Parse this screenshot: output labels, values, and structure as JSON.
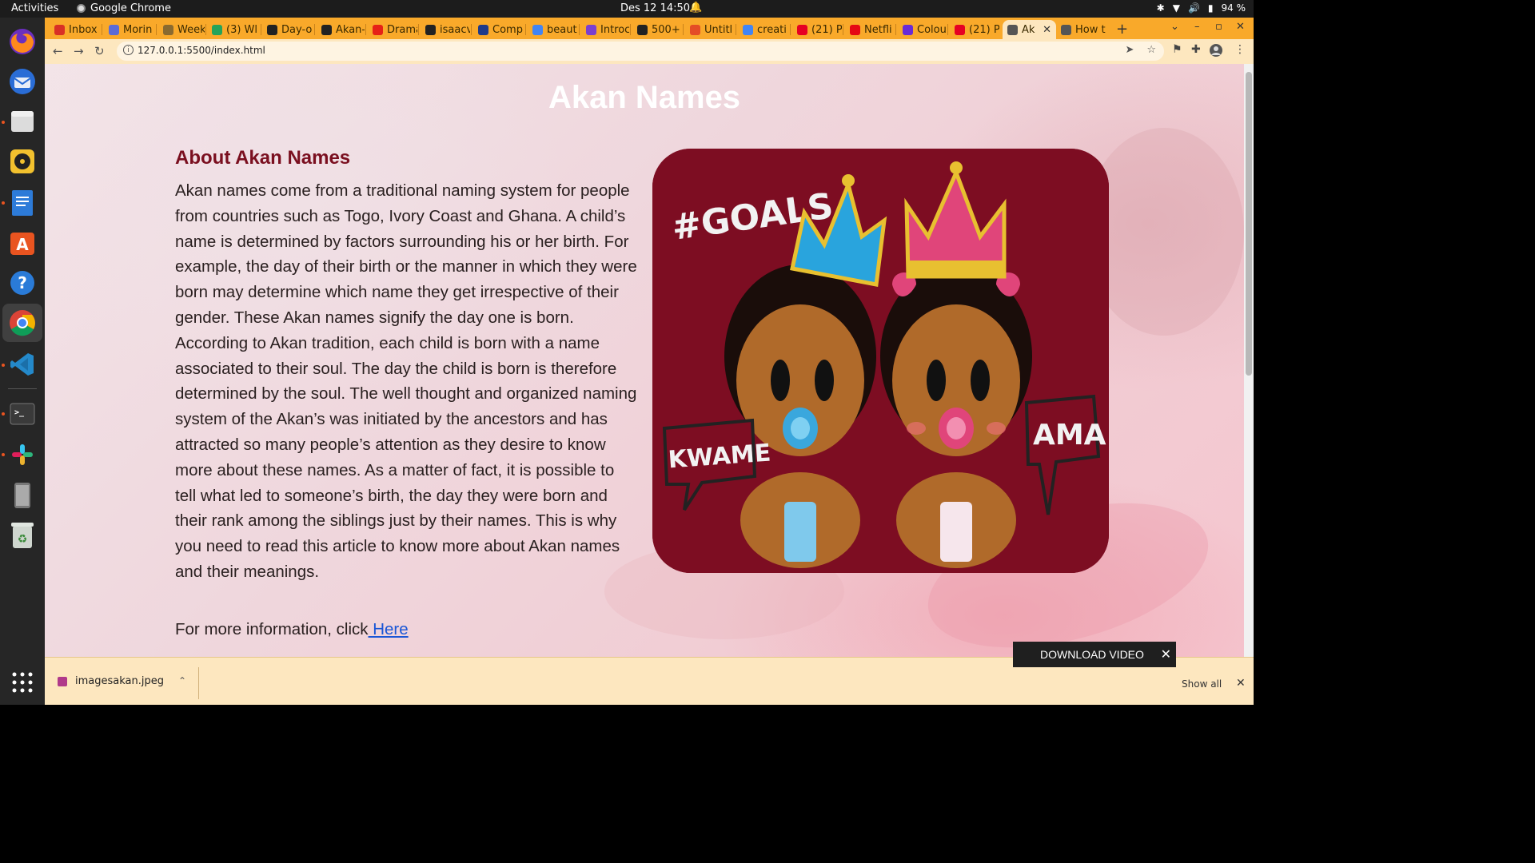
{
  "topbar": {
    "activities": "Activities",
    "app_name": "Google Chrome",
    "clock": "Des 12  14:50",
    "battery": "94 %"
  },
  "dock": {
    "items": [
      "firefox-icon",
      "thunderbird-icon",
      "files-icon",
      "rhythmbox-icon",
      "writer-icon",
      "software-icon",
      "help-icon",
      "chrome-icon",
      "vscode-icon",
      "terminal-icon",
      "slack-icon",
      "device-icon",
      "trash-icon",
      "show-apps-icon"
    ]
  },
  "tabs": [
    {
      "label": "Inbox",
      "icon": "gmail-icon",
      "color": "#d93025"
    },
    {
      "label": "Morin",
      "icon": "calendar-icon",
      "color": "#5b6bd6"
    },
    {
      "label": "Week",
      "icon": "pin-icon",
      "color": "#8a6a30"
    },
    {
      "label": "(3) Wl",
      "icon": "whatsapp-icon",
      "color": "#25a35a"
    },
    {
      "label": "Day-o",
      "icon": "github-icon",
      "color": "#222222"
    },
    {
      "label": "Akan-",
      "icon": "github-icon",
      "color": "#222222"
    },
    {
      "label": "Drama",
      "icon": "youtube-icon",
      "color": "#e62117"
    },
    {
      "label": "isaacv",
      "icon": "github-icon",
      "color": "#222222"
    },
    {
      "label": "Comp",
      "icon": "doc-icon",
      "color": "#1f3a8a"
    },
    {
      "label": "beaut",
      "icon": "google-icon",
      "color": "#4285f4"
    },
    {
      "label": "Introc",
      "icon": "b-icon",
      "color": "#7b3fd0"
    },
    {
      "label": "500+ \\",
      "icon": "bag-icon",
      "color": "#222222"
    },
    {
      "label": "Untitl",
      "icon": "figma-icon",
      "color": "#e44d26"
    },
    {
      "label": "creati",
      "icon": "google-icon",
      "color": "#4285f4"
    },
    {
      "label": "(21) P",
      "icon": "pinterest-icon",
      "color": "#e60023"
    },
    {
      "label": "Netfli",
      "icon": "netflix-icon",
      "color": "#e50914"
    },
    {
      "label": "Colou",
      "icon": "n-icon",
      "color": "#6a2bd6"
    },
    {
      "label": "(21) P",
      "icon": "pinterest-icon",
      "color": "#e60023"
    },
    {
      "label": "Ak",
      "icon": "globe-icon",
      "color": "#555555",
      "active": true
    },
    {
      "label": "How t",
      "icon": "globe-icon",
      "color": "#555555"
    }
  ],
  "toolbar": {
    "url": "127.0.0.1:5500/index.html"
  },
  "page": {
    "title": "Akan Names",
    "about_heading": "About Akan Names",
    "about_body": "Akan names come from a traditional naming system for people from countries such as Togo, Ivory Coast and Ghana. A child’s name is determined by factors surrounding his or her birth. For example, the day of their birth or the manner in which they were born may determine which name they get irrespective of their gender. These Akan names signify the day one is born. According to Akan tradition, each child is born with a name associated to their soul. The day the child is born is therefore determined by the soul. The well thought and organized naming system of the Akan’s was initiated by the ancestors and has attracted so many people’s attention as they desire to know more about these names. As a matter of fact, it is possible to tell what led to someone’s birth, the day they were born and their rank among the siblings just by their names. This is why you need to read this article to know more about Akan names and their meanings.",
    "more_info_prefix": "For more information, click",
    "more_info_link": " Here",
    "hero_image": {
      "goals_text": "#GOALS",
      "left_name": "KWAME",
      "right_name": "AMA"
    }
  },
  "download_shelf": {
    "file_name": "imagesakan.jpeg",
    "show_all": "Show all"
  },
  "overlay": {
    "download_video": "DOWNLOAD VIDEO"
  }
}
